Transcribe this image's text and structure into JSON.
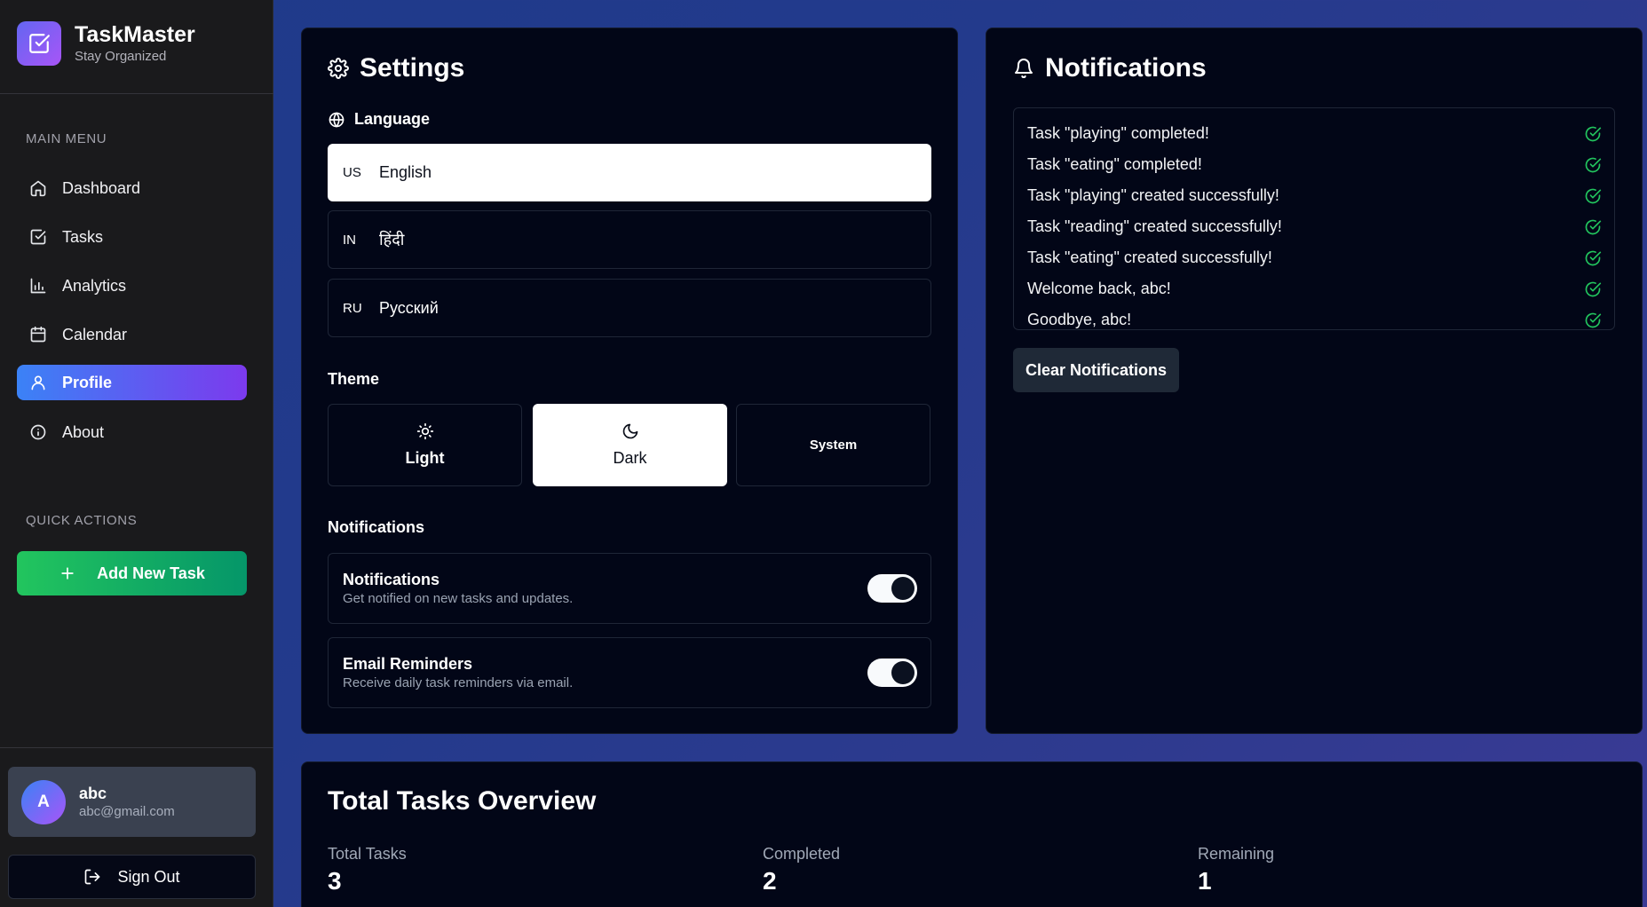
{
  "brand": {
    "name": "TaskMaster",
    "tagline": "Stay Organized",
    "icon": "checkbox-icon"
  },
  "sidebar": {
    "main_menu_title": "MAIN MENU",
    "items": [
      {
        "label": "Dashboard",
        "icon": "home-icon"
      },
      {
        "label": "Tasks",
        "icon": "checkbox-icon"
      },
      {
        "label": "Analytics",
        "icon": "bar-chart-icon"
      },
      {
        "label": "Calendar",
        "icon": "calendar-icon"
      },
      {
        "label": "Profile",
        "icon": "user-icon",
        "active": true
      },
      {
        "label": "About",
        "icon": "info-icon"
      }
    ],
    "quick_actions_title": "QUICK ACTIONS",
    "add_task_label": "Add New Task",
    "user": {
      "avatar_letter": "A",
      "name": "abc",
      "email": "abc@gmail.com"
    },
    "sign_out_label": "Sign Out"
  },
  "settings": {
    "title": "Settings",
    "language_label": "Language",
    "languages": [
      {
        "code": "US",
        "name": "English",
        "selected": true
      },
      {
        "code": "IN",
        "name": "हिंदी"
      },
      {
        "code": "RU",
        "name": "Русский"
      }
    ],
    "theme_label": "Theme",
    "themes": [
      {
        "label": "Light",
        "icon": "sun-icon"
      },
      {
        "label": "Dark",
        "icon": "moon-icon",
        "selected": true
      },
      {
        "label": "System"
      }
    ],
    "notifications_label": "Notifications",
    "toggles": [
      {
        "title": "Notifications",
        "description": "Get notified on new tasks and updates.",
        "on": true
      },
      {
        "title": "Email Reminders",
        "description": "Receive daily task reminders via email.",
        "on": true
      }
    ]
  },
  "notifications": {
    "title": "Notifications",
    "items": [
      "Task \"playing\" completed!",
      "Task \"eating\" completed!",
      "Task \"playing\" created successfully!",
      "Task \"reading\" created successfully!",
      "Task \"eating\" created successfully!",
      "Welcome back, abc!",
      "Goodbye, abc!"
    ],
    "clear_label": "Clear Notifications"
  },
  "overview": {
    "title": "Total Tasks Overview",
    "stats": [
      {
        "label": "Total Tasks",
        "value": "3"
      },
      {
        "label": "Completed",
        "value": "2"
      },
      {
        "label": "Remaining",
        "value": "1"
      }
    ]
  },
  "colors": {
    "accent_gradient_start": "#3b82f6",
    "accent_gradient_end": "#7c3aed",
    "success": "#22c55e",
    "panel_bg": "#020617",
    "sidebar_bg": "#1a1a1c"
  }
}
